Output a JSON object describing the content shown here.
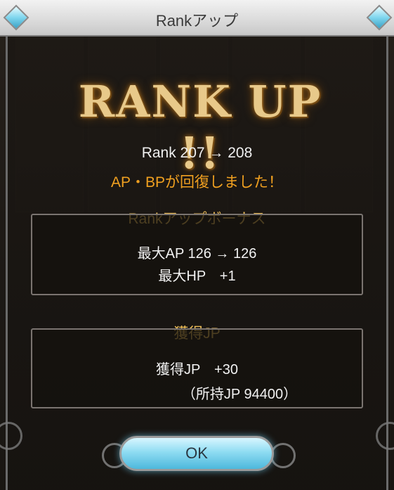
{
  "window": {
    "title": "Rankアップ"
  },
  "banner": {
    "text": "RANK UP !!"
  },
  "rank": {
    "text": "Rank 207 → 208"
  },
  "recovery": {
    "text": "AP・BPが回復しました！"
  },
  "rank_bonus": {
    "title": "Rankアップボーナス",
    "max_ap": "最大AP 126 → 126",
    "max_hp": "最大HP　+1"
  },
  "jp": {
    "title": "獲得JP",
    "earned": "獲得JP　+30",
    "owned": "（所持JP 94400）"
  },
  "buttons": {
    "ok_label": "OK"
  },
  "colors": {
    "accent_orange": "#f0a020",
    "section_gold": "#f2c15a",
    "button_blue": "#8fdcf2"
  }
}
